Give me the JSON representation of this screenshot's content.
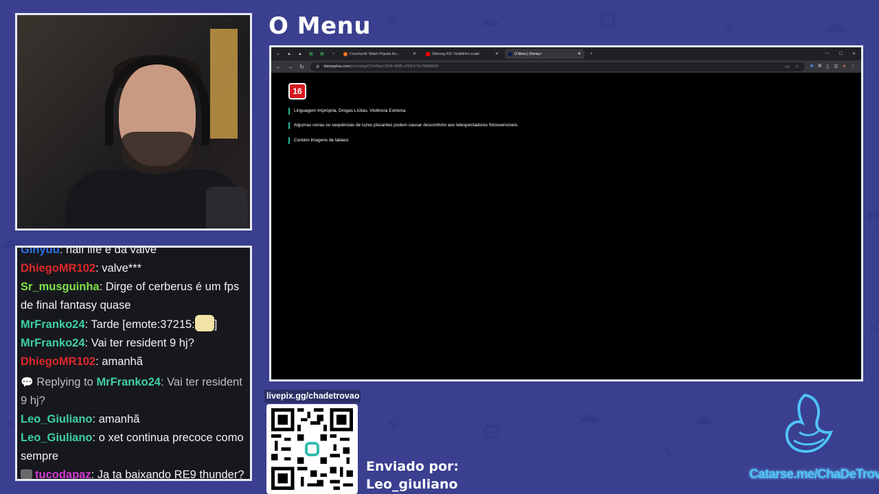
{
  "overlay": {
    "title": "O Menu",
    "livepix_label": "livepix.gg/chadetrovao",
    "sent_by_label": "Enviado por:",
    "sent_by_user": "Leo_giuliano",
    "catarse_link": "Catarse.me/ChaDeTrovao"
  },
  "chat": {
    "messages": [
      {
        "user": "Ginyuu",
        "color": "#2f6fe0",
        "text": "half life é da valve"
      },
      {
        "user": "DhiegoMR102",
        "color": "#e0282a",
        "text": "valve***"
      },
      {
        "user": "Sr_musguinha",
        "color": "#7ee24a",
        "text": "Dirge of cerberus é um fps de final fantasy quase"
      },
      {
        "user": "MrFranko24",
        "color": "#3fd0a6",
        "text": "Tarde [emote:37215:",
        "suffix": "]"
      },
      {
        "user": "MrFranko24",
        "color": "#3fd0a6",
        "text": "Vai ter resident 9 hj?"
      },
      {
        "user": "DhiegoMR102",
        "color": "#e0282a",
        "text": "amanhã"
      },
      {
        "reply_prefix": "Replying to",
        "reply_user": "MrFranko24",
        "reply_user_color": "#3fd0a6",
        "reply_text": "Vai ter resident 9 hj?"
      },
      {
        "user": "Leo_Giuliano",
        "color": "#3fd0a6",
        "text": "amanhã"
      },
      {
        "user": "Leo_Giuliano",
        "color": "#3fd0a6",
        "text": "o xet continua precoce como sempre"
      },
      {
        "user": "tucodapaz",
        "color": "#d63ad6",
        "text": "Ja ta baixando RE9 thunder?"
      }
    ]
  },
  "browser": {
    "tabs": [
      {
        "label": "Crunchyroll: Watch Popular An...",
        "active": false
      },
      {
        "label": "Silksong #02: Vestidinho vcadé",
        "active": false
      },
      {
        "label": "O Menu | Disney+",
        "active": true
      }
    ],
    "url_domain": "disneyplus.com",
    "url_path": "/pt-br/play/f12c46ed-2536-4995-a759-574c79045604",
    "rating": "16",
    "advisories": [
      "Linguagem Imprópria, Drogas Lícitas, Violência Extrema",
      "Algumas cenas ou sequências de luzes piscantes podem causar desconforto aos telespectadores fotossensíveis.",
      "Contém imagens de tabaco"
    ]
  }
}
